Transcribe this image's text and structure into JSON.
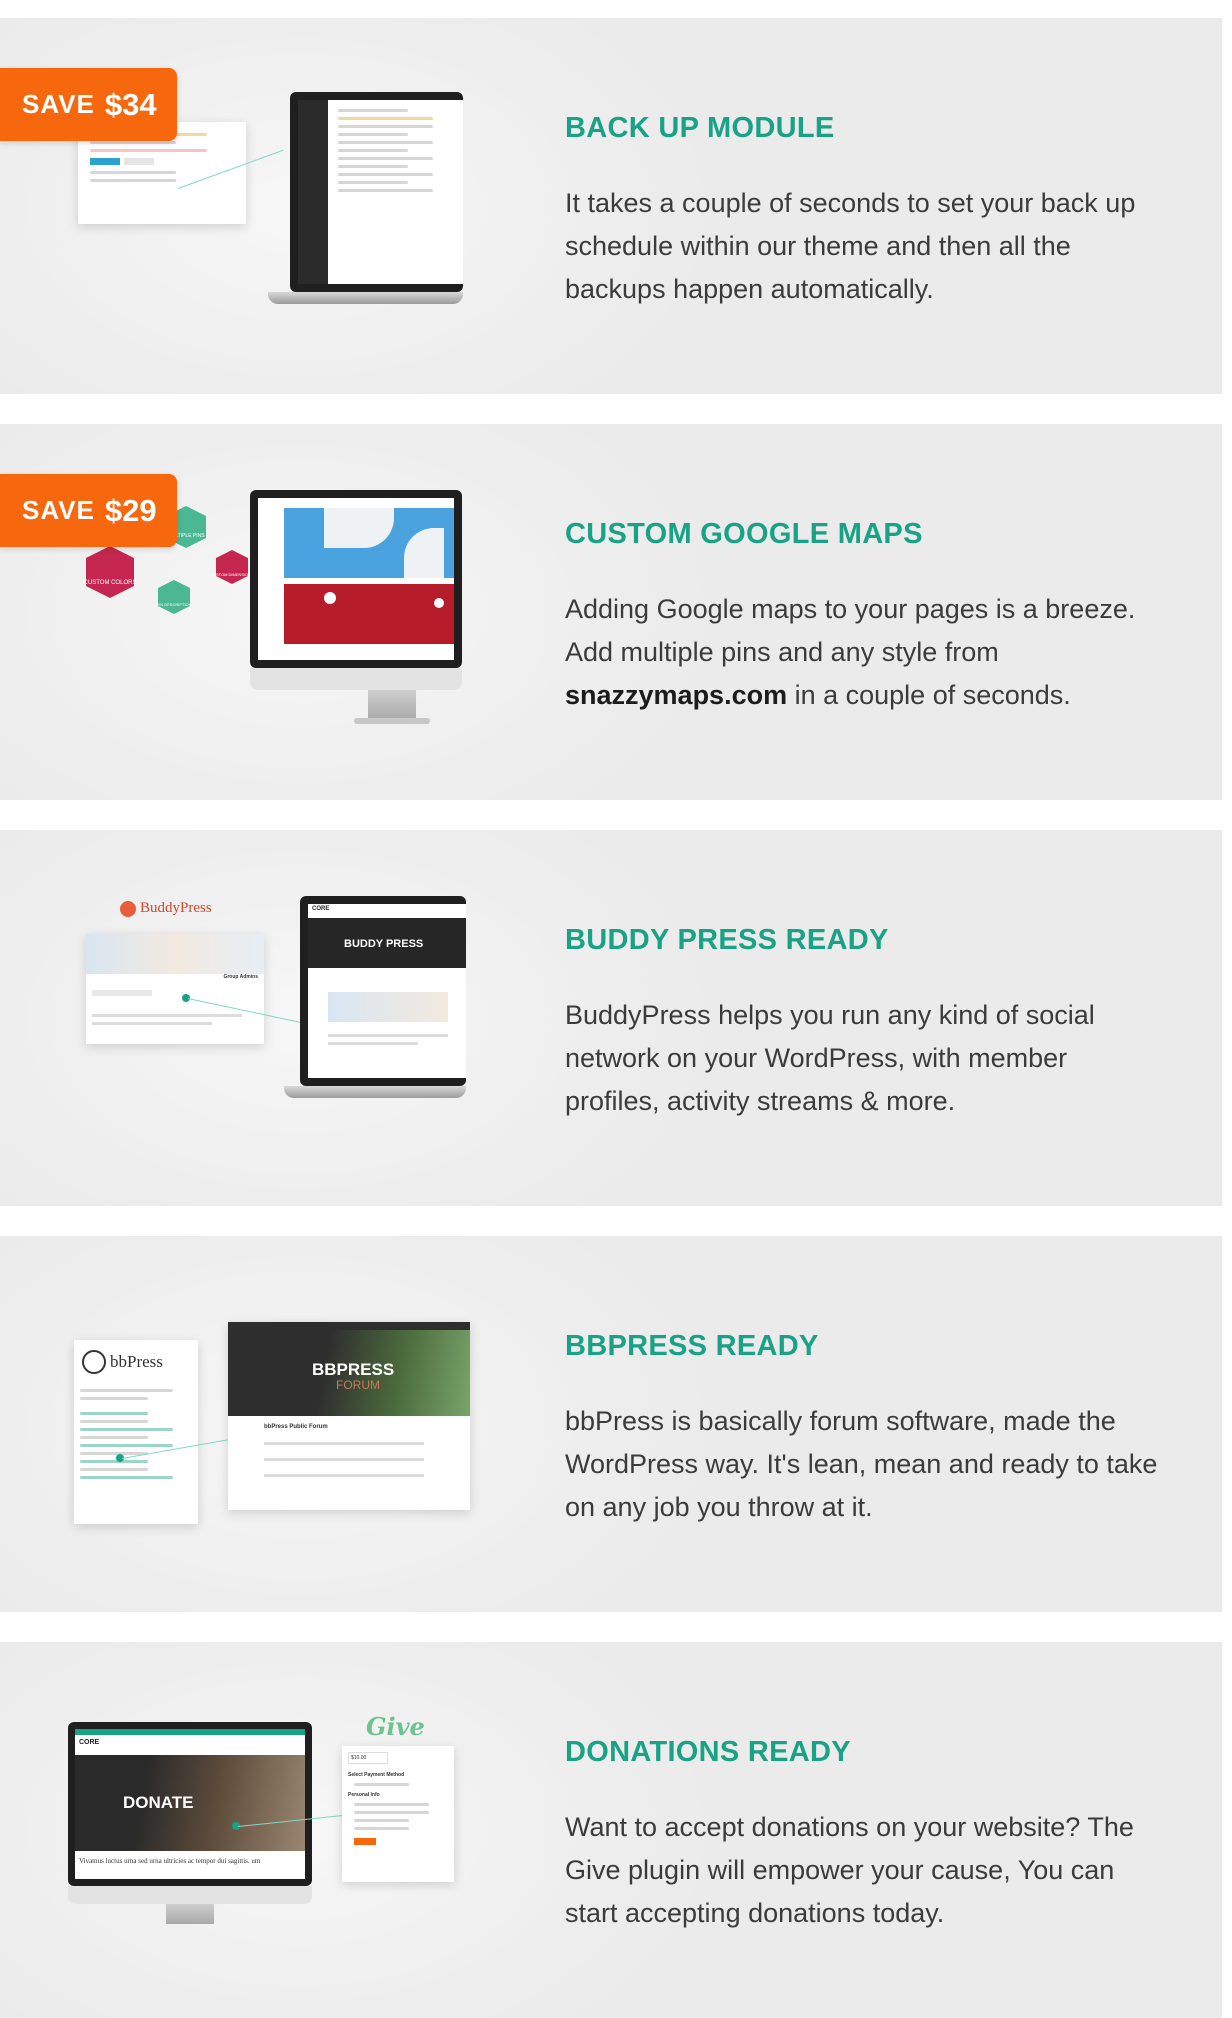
{
  "features": [
    {
      "id": "backup",
      "badge": {
        "word": "SAVE",
        "amount": "$34"
      },
      "title": "BACK UP MODULE",
      "description": "It takes a couple of seconds to set your back up schedule within our theme and then all the backups happen automatically."
    },
    {
      "id": "maps",
      "badge": {
        "word": "SAVE",
        "amount": "$29"
      },
      "title": "CUSTOM GOOGLE MAPS",
      "description_before": "Adding Google maps to your pages is a breeze. Add multiple pins and any style from ",
      "description_link": "snazzymaps.com",
      "description_after": " in a couple of seconds.",
      "hex_labels": [
        "MULTIPLE PINS",
        "CUSTOM COLORS",
        "CUSTOM DIMENSIONS",
        "PIN DESCRIPTION"
      ]
    },
    {
      "id": "buddypress",
      "title": "BUDDY PRESS READY",
      "description": "BuddyPress helps you run any kind of social network on your WordPress, with member profiles, activity streams & more.",
      "logo_text": "BuddyPress",
      "screen_heading": "BUDDY PRESS",
      "screen_brand": "CORE",
      "group_label": "Group Admins"
    },
    {
      "id": "bbpress",
      "title": "BBPRESS READY",
      "description": "bbPress is basically forum software, made the WordPress way. It's lean, mean and ready to take on any job you throw at it.",
      "logo_text": "bbPress",
      "screen_heading": "BBPRESS",
      "screen_sub": "FORUM",
      "forum_title": "bbPress Public Forum"
    },
    {
      "id": "donations",
      "title": "DONATIONS READY",
      "description": "Want to accept donations on your website? The Give plugin will empower your cause, You can start accepting donations today.",
      "logo_text": "Give",
      "screen_heading": "DONATE",
      "screen_brand": "CORE",
      "screen_caption": "Vivamus luctus urna sed urna ultricies ac tempor dui sagittis. um",
      "form_amount": "$10.00",
      "form_method_label": "Select Payment Method",
      "form_section": "Personal Info"
    }
  ],
  "colors": {
    "accent": "#19a286",
    "badge": "#f7670e",
    "panel_bg": "#eeeeee",
    "text": "#3b3b3b",
    "hex_red": "#c42650",
    "hex_green": "#4cb793"
  }
}
